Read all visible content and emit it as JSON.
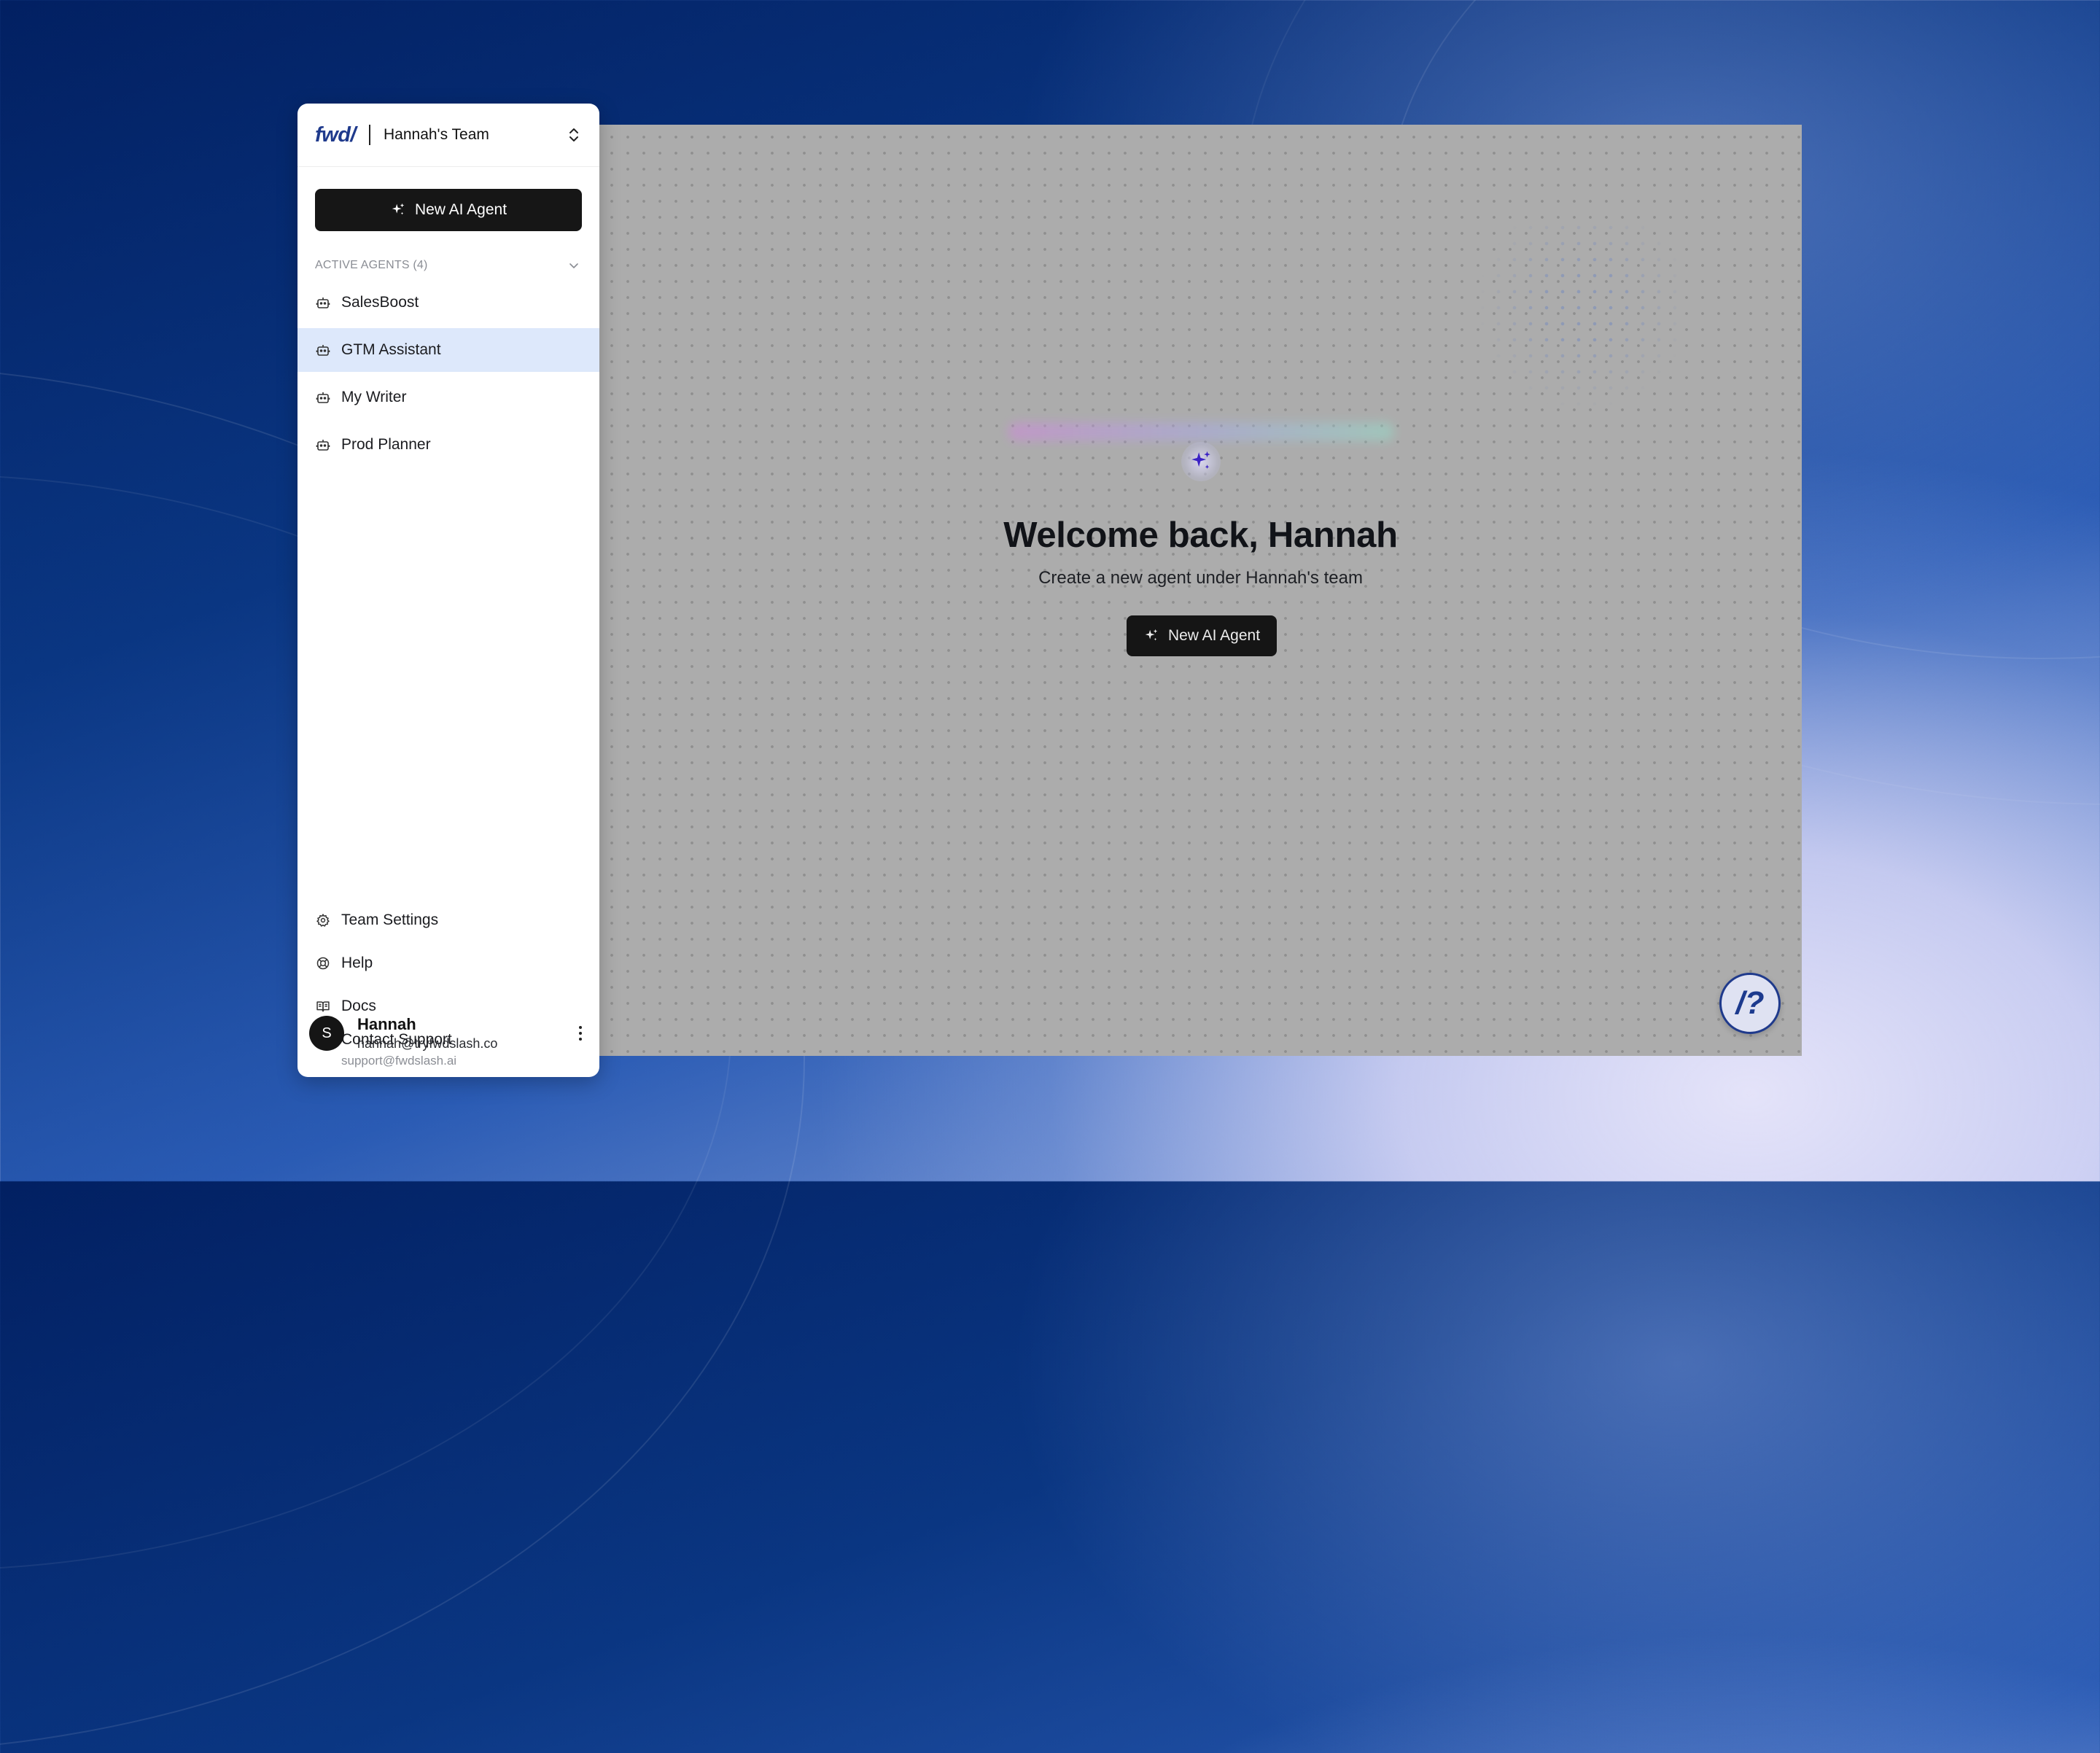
{
  "sidebar": {
    "logo": "fwd/",
    "team_name": "Hannah's Team",
    "new_agent_label": "New AI Agent",
    "section_title": "ACTIVE AGENTS (4)",
    "agents": [
      {
        "label": "SalesBoost"
      },
      {
        "label": "GTM Assistant"
      },
      {
        "label": "My Writer"
      },
      {
        "label": "Prod Planner"
      }
    ],
    "active_agent_index": 1,
    "nav": {
      "team_settings": "Team Settings",
      "help": "Help",
      "docs": "Docs",
      "contact_support": "Contact Support",
      "support_email": "support@fwdslash.ai"
    },
    "user": {
      "avatar_initial": "S",
      "name": "Hannah",
      "email": "hannah@tryfwdslash.co"
    }
  },
  "main": {
    "welcome_title": "Welcome back, Hannah",
    "subtitle": "Create a new agent under Hannah's team",
    "new_agent_label": "New AI Agent",
    "help_fab_label": "/?"
  },
  "colors": {
    "brand": "#1f3a8c",
    "primary_button": "#161616",
    "active_item_bg": "#dde8fb",
    "sparkle_accent": "#3b22c4"
  },
  "icons": {
    "chevron": "chevron-up-down-icon",
    "sparkle": "sparkle-icon",
    "agent": "robot-icon",
    "settings": "gear-icon",
    "help": "lifebuoy-icon",
    "docs": "book-icon",
    "support": "copy-icon",
    "menu": "kebab-menu-icon"
  }
}
